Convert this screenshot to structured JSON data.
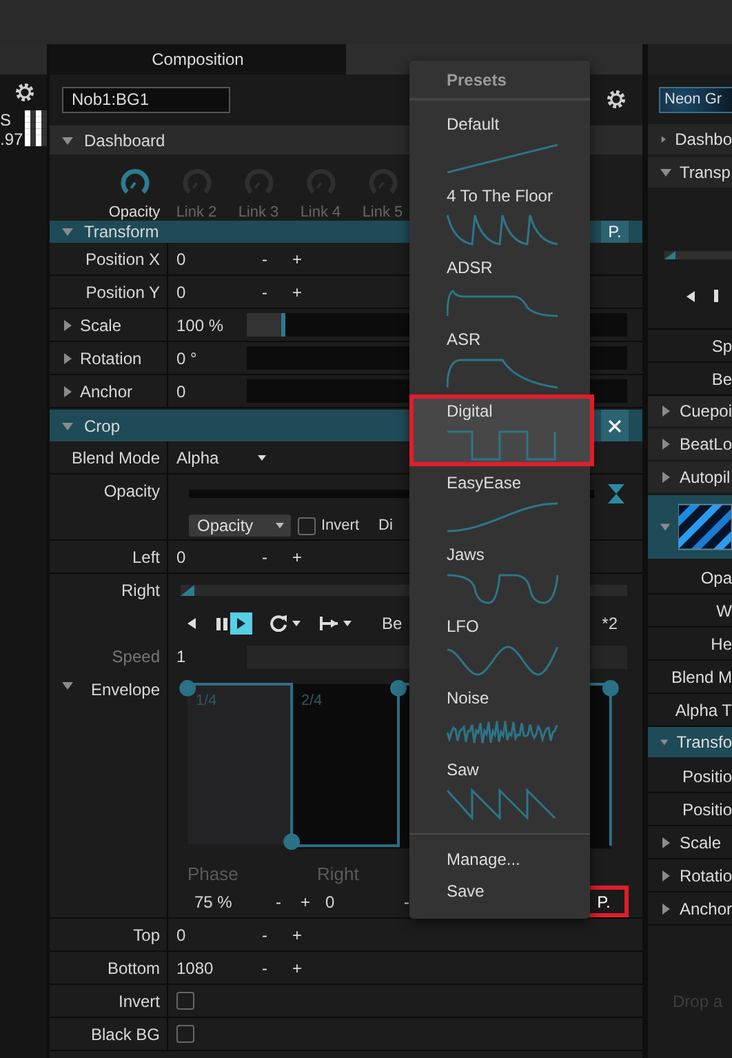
{
  "left_panel": {
    "texts": [
      "S",
      ".97"
    ]
  },
  "composition_panel": {
    "tabs": [
      {
        "label": "Composition",
        "selected": true
      },
      {
        "selected": false
      }
    ],
    "layer_name": "Nob1:BG1",
    "dashboard": {
      "title": "Dashboard",
      "expanded": true,
      "knobs": [
        {
          "label": "Opacity",
          "active": true
        },
        {
          "label": "Link 2",
          "active": false
        },
        {
          "label": "Link 3",
          "active": false
        },
        {
          "label": "Link 4",
          "active": false
        },
        {
          "label": "Link 5",
          "active": false
        }
      ]
    },
    "transform": {
      "title": "Transform",
      "expanded": true,
      "preset_button": "P.",
      "rows": [
        {
          "kind": "stepper",
          "label": "Position X",
          "value": "0",
          "buttons": [
            "-",
            "+"
          ]
        },
        {
          "kind": "stepper",
          "label": "Position Y",
          "value": "0",
          "buttons": [
            "-",
            "+"
          ]
        },
        {
          "kind": "slider",
          "label": "Scale",
          "value": "100 %",
          "expanded": false,
          "level": 0.1
        },
        {
          "kind": "slider",
          "label": "Rotation",
          "value": "0 °",
          "expanded": false
        },
        {
          "kind": "slider",
          "label": "Anchor",
          "value": "0",
          "expanded": false
        }
      ]
    },
    "crop": {
      "title": "Crop",
      "expanded": true,
      "rows": [
        {
          "kind": "dropdown",
          "label": "Blend Mode",
          "value": "Alpha"
        },
        {
          "kind": "mask",
          "label": "Opacity",
          "source": "Opacity",
          "invert": {
            "label": "Invert",
            "checked": false
          },
          "cut_text": "Di"
        },
        {
          "kind": "stepper",
          "label": "Left",
          "value": "0",
          "buttons": [
            "-",
            "+"
          ]
        },
        {
          "kind": "envelope",
          "label": "Right",
          "transport": [
            {
              "kind": "back",
              "selected": false
            },
            {
              "kind": "pause",
              "selected": false
            },
            {
              "kind": "play",
              "selected": true
            },
            {
              "kind": "loop",
              "selected": false
            },
            {
              "kind": "hold",
              "selected": false
            }
          ],
          "beat_text": "Be",
          "multiplier": "*2",
          "speed": {
            "label": "Speed",
            "value": "1",
            "disabled": true
          },
          "envelope": {
            "label": "Envelope",
            "expanded": true,
            "marks": [
              "1/4",
              "2/4"
            ]
          },
          "phase": {
            "label": "Phase",
            "value": "75 %",
            "buttons": [
              "-",
              "+"
            ]
          },
          "right": {
            "label": "Right",
            "value": "0",
            "buttons": [
              "-"
            ]
          },
          "preset_button": {
            "label": "P.",
            "highlighted": true
          }
        },
        {
          "kind": "stepper",
          "label": "Top",
          "value": "0",
          "buttons": [
            "-",
            "+"
          ]
        },
        {
          "kind": "stepper",
          "label": "Bottom",
          "value": "1080",
          "buttons": [
            "-",
            "+"
          ]
        },
        {
          "kind": "checkbox",
          "label": "Invert",
          "checked": false
        },
        {
          "kind": "checkbox",
          "label": "Black BG",
          "checked": false
        }
      ]
    }
  },
  "presets_menu": {
    "title": "Presets",
    "items": [
      {
        "label": "Default",
        "kind": "ramp",
        "selected": false
      },
      {
        "label": "4 To The Floor",
        "kind": "pulse",
        "selected": false
      },
      {
        "label": "ADSR",
        "kind": "adsr",
        "selected": false
      },
      {
        "label": "ASR",
        "kind": "asr",
        "selected": false
      },
      {
        "label": "Digital",
        "kind": "square",
        "selected": true
      },
      {
        "label": "EasyEase",
        "kind": "ease",
        "selected": false
      },
      {
        "label": "Jaws",
        "kind": "jaws",
        "selected": false
      },
      {
        "label": "LFO",
        "kind": "sine",
        "selected": false
      },
      {
        "label": "Noise",
        "kind": "noise",
        "selected": false
      },
      {
        "label": "Saw",
        "kind": "saw",
        "selected": false
      }
    ],
    "actions": [
      "Manage...",
      "Save"
    ]
  },
  "right_panel": {
    "name_field": "Neon Gr",
    "rows": [
      {
        "kind": "header",
        "label": "Dashbo",
        "expanded": false
      },
      {
        "kind": "header",
        "label": "Transp",
        "expanded": true
      },
      {
        "kind": "transport"
      },
      {
        "kind": "field",
        "label": "Sp"
      },
      {
        "kind": "field",
        "label": "Be"
      },
      {
        "kind": "header",
        "label": "Cuepoi",
        "expanded": false
      },
      {
        "kind": "header",
        "label": "BeatLo",
        "expanded": false
      },
      {
        "kind": "header",
        "label": "Autopil",
        "expanded": false
      },
      {
        "kind": "thumbnail",
        "expanded": true
      },
      {
        "kind": "field",
        "label": "Opa"
      },
      {
        "kind": "field",
        "label": "W"
      },
      {
        "kind": "field",
        "label": "He"
      },
      {
        "kind": "field",
        "label": "Blend M"
      },
      {
        "kind": "field",
        "label": "Alpha T"
      },
      {
        "kind": "section",
        "label": "Transfo",
        "expanded": true
      },
      {
        "kind": "field",
        "label": "Positio"
      },
      {
        "kind": "field",
        "label": "Positio"
      },
      {
        "kind": "expander",
        "label": "Scale",
        "expanded": false
      },
      {
        "kind": "expander",
        "label": "Rotatio",
        "expanded": false
      },
      {
        "kind": "expander",
        "label": "Anchor",
        "expanded": false
      }
    ],
    "drop_hint": "Drop a"
  }
}
